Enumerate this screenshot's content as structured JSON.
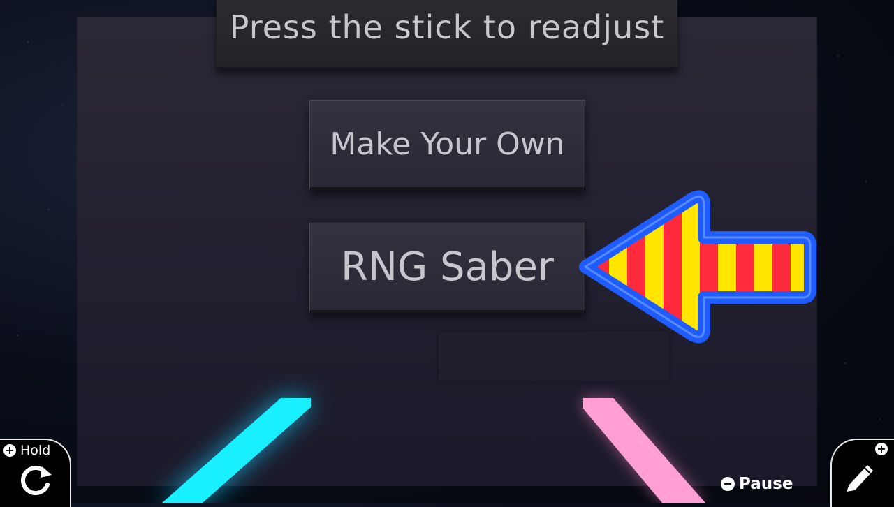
{
  "banner": {
    "text": "Press the stick to readjust"
  },
  "menu": {
    "items": [
      {
        "label": "Make Your Own"
      },
      {
        "label": "RNG Saber"
      }
    ],
    "selected_index": 1
  },
  "hud": {
    "hold_label": "Hold",
    "pause_label": "Pause",
    "left_icon": "rotate-icon",
    "right_icon": "pencil-icon"
  },
  "colors": {
    "arrow_outline": "#1f5cff",
    "arrow_stripe_a": "#ff2a3c",
    "arrow_stripe_b": "#ffe500",
    "saber_left": "#18f0ff",
    "saber_right": "#ff9fd6"
  }
}
